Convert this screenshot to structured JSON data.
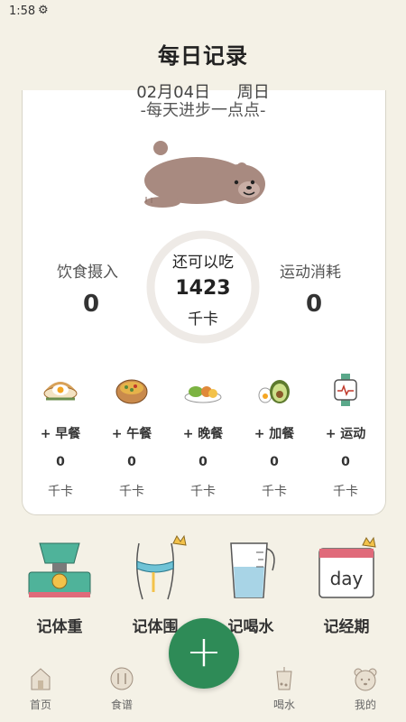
{
  "status": {
    "time": "1:58"
  },
  "header": {
    "title": "每日记录",
    "date": "02月04日",
    "weekday": "周日",
    "motto": "-每天进步一点点-"
  },
  "summary": {
    "intake_label": "饮食摄入",
    "intake_value": "0",
    "remaining_label": "还可以吃",
    "remaining_value": "1423",
    "remaining_unit": "千卡",
    "burn_label": "运动消耗",
    "burn_value": "0"
  },
  "meals": [
    {
      "label": "+ 早餐",
      "value": "0",
      "unit": "千卡",
      "icon": "breakfast-icon"
    },
    {
      "label": "+ 午餐",
      "value": "0",
      "unit": "千卡",
      "icon": "lunch-icon"
    },
    {
      "label": "+ 晚餐",
      "value": "0",
      "unit": "千卡",
      "icon": "dinner-icon"
    },
    {
      "label": "+ 加餐",
      "value": "0",
      "unit": "千卡",
      "icon": "snack-icon"
    },
    {
      "label": "+ 运动",
      "value": "0",
      "unit": "千卡",
      "icon": "exercise-icon"
    }
  ],
  "tools": [
    {
      "label": "记体重",
      "icon": "scale-icon"
    },
    {
      "label": "记体围",
      "icon": "body-measure-icon"
    },
    {
      "label": "记喝水",
      "icon": "water-cup-icon"
    },
    {
      "label": "记经期",
      "icon": "calendar-day-icon",
      "icon_text": "day"
    }
  ],
  "fab": {
    "symbol": "+"
  },
  "nav": [
    {
      "label": "首页",
      "icon": "home-icon"
    },
    {
      "label": "食谱",
      "icon": "recipe-icon"
    },
    {
      "label": "喝水",
      "icon": "drink-icon"
    },
    {
      "label": "我的",
      "icon": "bear-profile-icon"
    }
  ],
  "colors": {
    "background": "#f4f1e6",
    "accent_green": "#2e8b57",
    "bear": "#a88a80",
    "ring": "#eeeae6"
  }
}
